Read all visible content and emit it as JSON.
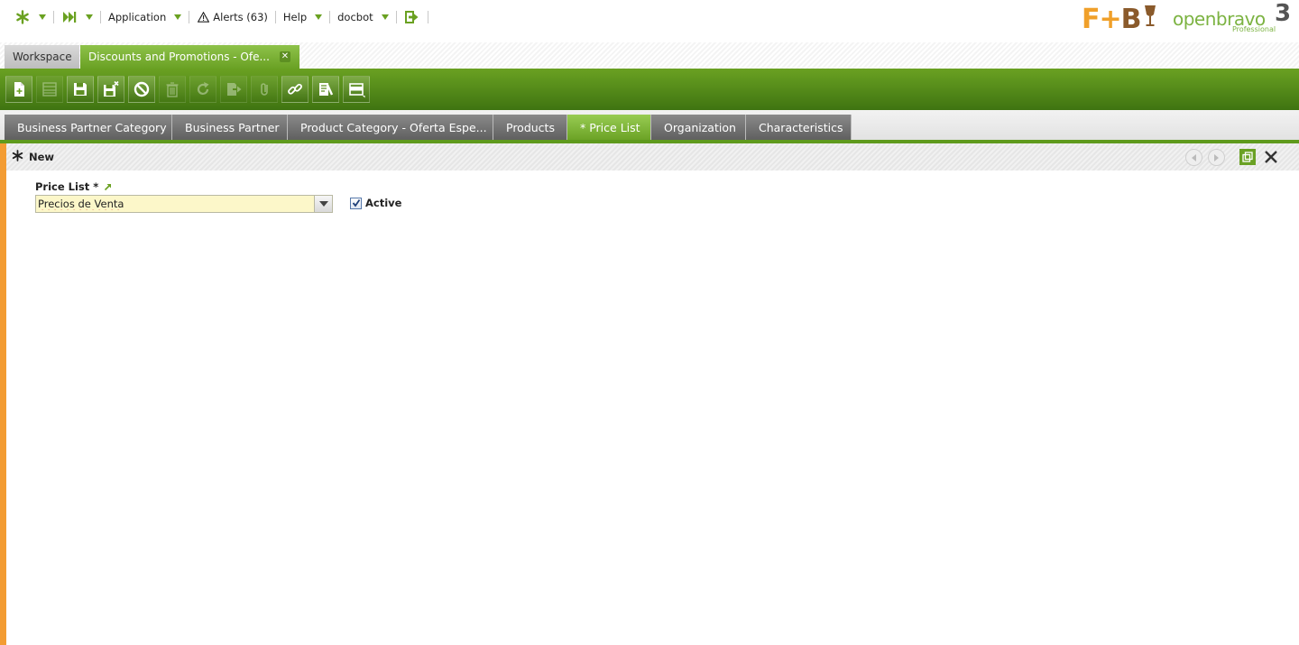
{
  "topnav": {
    "application_label": "Application",
    "alerts_label": "Alerts (63)",
    "help_label": "Help",
    "user_label": "docbot"
  },
  "logos": {
    "fb_text_f": "F+",
    "fb_text_b": "B",
    "openbravo_text": "openbravo",
    "openbravo_version": "3",
    "openbravo_edition": "Professional"
  },
  "window_tabs": {
    "workspace_label": "Workspace",
    "active_label": "Discounts and Promotions - Ofe..."
  },
  "record_tabs": [
    {
      "label": "Business Partner Category"
    },
    {
      "label": "Business Partner"
    },
    {
      "label": "Product Category - Oferta Espe..."
    },
    {
      "label": "Products"
    },
    {
      "label": "* Price List"
    },
    {
      "label": "Organization"
    },
    {
      "label": "Characteristics"
    }
  ],
  "status": {
    "title": "New"
  },
  "form": {
    "price_list_label": "Price List *",
    "price_list_value": "Precios de Venta",
    "active_label": "Active",
    "active_checked": true
  },
  "colors": {
    "brand_green": "#6aa124",
    "accent_orange": "#f39c33",
    "required_field_bg": "#fcf7c9"
  }
}
